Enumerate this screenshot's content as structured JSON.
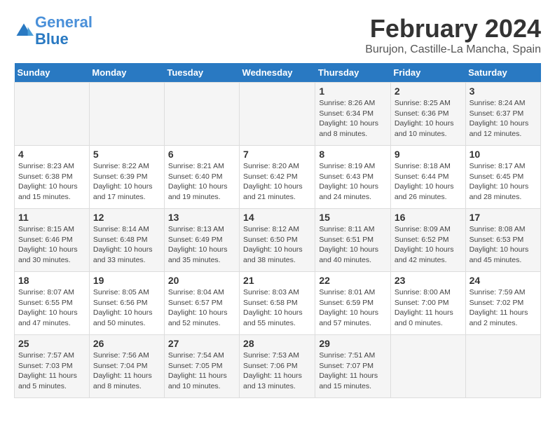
{
  "header": {
    "logo_line1": "General",
    "logo_line2": "Blue",
    "month_year": "February 2024",
    "location": "Burujon, Castille-La Mancha, Spain"
  },
  "days_of_week": [
    "Sunday",
    "Monday",
    "Tuesday",
    "Wednesday",
    "Thursday",
    "Friday",
    "Saturday"
  ],
  "weeks": [
    {
      "days": [
        {
          "num": "",
          "info": ""
        },
        {
          "num": "",
          "info": ""
        },
        {
          "num": "",
          "info": ""
        },
        {
          "num": "",
          "info": ""
        },
        {
          "num": "1",
          "info": "Sunrise: 8:26 AM\nSunset: 6:34 PM\nDaylight: 10 hours\nand 8 minutes."
        },
        {
          "num": "2",
          "info": "Sunrise: 8:25 AM\nSunset: 6:36 PM\nDaylight: 10 hours\nand 10 minutes."
        },
        {
          "num": "3",
          "info": "Sunrise: 8:24 AM\nSunset: 6:37 PM\nDaylight: 10 hours\nand 12 minutes."
        }
      ]
    },
    {
      "days": [
        {
          "num": "4",
          "info": "Sunrise: 8:23 AM\nSunset: 6:38 PM\nDaylight: 10 hours\nand 15 minutes."
        },
        {
          "num": "5",
          "info": "Sunrise: 8:22 AM\nSunset: 6:39 PM\nDaylight: 10 hours\nand 17 minutes."
        },
        {
          "num": "6",
          "info": "Sunrise: 8:21 AM\nSunset: 6:40 PM\nDaylight: 10 hours\nand 19 minutes."
        },
        {
          "num": "7",
          "info": "Sunrise: 8:20 AM\nSunset: 6:42 PM\nDaylight: 10 hours\nand 21 minutes."
        },
        {
          "num": "8",
          "info": "Sunrise: 8:19 AM\nSunset: 6:43 PM\nDaylight: 10 hours\nand 24 minutes."
        },
        {
          "num": "9",
          "info": "Sunrise: 8:18 AM\nSunset: 6:44 PM\nDaylight: 10 hours\nand 26 minutes."
        },
        {
          "num": "10",
          "info": "Sunrise: 8:17 AM\nSunset: 6:45 PM\nDaylight: 10 hours\nand 28 minutes."
        }
      ]
    },
    {
      "days": [
        {
          "num": "11",
          "info": "Sunrise: 8:15 AM\nSunset: 6:46 PM\nDaylight: 10 hours\nand 30 minutes."
        },
        {
          "num": "12",
          "info": "Sunrise: 8:14 AM\nSunset: 6:48 PM\nDaylight: 10 hours\nand 33 minutes."
        },
        {
          "num": "13",
          "info": "Sunrise: 8:13 AM\nSunset: 6:49 PM\nDaylight: 10 hours\nand 35 minutes."
        },
        {
          "num": "14",
          "info": "Sunrise: 8:12 AM\nSunset: 6:50 PM\nDaylight: 10 hours\nand 38 minutes."
        },
        {
          "num": "15",
          "info": "Sunrise: 8:11 AM\nSunset: 6:51 PM\nDaylight: 10 hours\nand 40 minutes."
        },
        {
          "num": "16",
          "info": "Sunrise: 8:09 AM\nSunset: 6:52 PM\nDaylight: 10 hours\nand 42 minutes."
        },
        {
          "num": "17",
          "info": "Sunrise: 8:08 AM\nSunset: 6:53 PM\nDaylight: 10 hours\nand 45 minutes."
        }
      ]
    },
    {
      "days": [
        {
          "num": "18",
          "info": "Sunrise: 8:07 AM\nSunset: 6:55 PM\nDaylight: 10 hours\nand 47 minutes."
        },
        {
          "num": "19",
          "info": "Sunrise: 8:05 AM\nSunset: 6:56 PM\nDaylight: 10 hours\nand 50 minutes."
        },
        {
          "num": "20",
          "info": "Sunrise: 8:04 AM\nSunset: 6:57 PM\nDaylight: 10 hours\nand 52 minutes."
        },
        {
          "num": "21",
          "info": "Sunrise: 8:03 AM\nSunset: 6:58 PM\nDaylight: 10 hours\nand 55 minutes."
        },
        {
          "num": "22",
          "info": "Sunrise: 8:01 AM\nSunset: 6:59 PM\nDaylight: 10 hours\nand 57 minutes."
        },
        {
          "num": "23",
          "info": "Sunrise: 8:00 AM\nSunset: 7:00 PM\nDaylight: 11 hours\nand 0 minutes."
        },
        {
          "num": "24",
          "info": "Sunrise: 7:59 AM\nSunset: 7:02 PM\nDaylight: 11 hours\nand 2 minutes."
        }
      ]
    },
    {
      "days": [
        {
          "num": "25",
          "info": "Sunrise: 7:57 AM\nSunset: 7:03 PM\nDaylight: 11 hours\nand 5 minutes."
        },
        {
          "num": "26",
          "info": "Sunrise: 7:56 AM\nSunset: 7:04 PM\nDaylight: 11 hours\nand 8 minutes."
        },
        {
          "num": "27",
          "info": "Sunrise: 7:54 AM\nSunset: 7:05 PM\nDaylight: 11 hours\nand 10 minutes."
        },
        {
          "num": "28",
          "info": "Sunrise: 7:53 AM\nSunset: 7:06 PM\nDaylight: 11 hours\nand 13 minutes."
        },
        {
          "num": "29",
          "info": "Sunrise: 7:51 AM\nSunset: 7:07 PM\nDaylight: 11 hours\nand 15 minutes."
        },
        {
          "num": "",
          "info": ""
        },
        {
          "num": "",
          "info": ""
        }
      ]
    }
  ]
}
